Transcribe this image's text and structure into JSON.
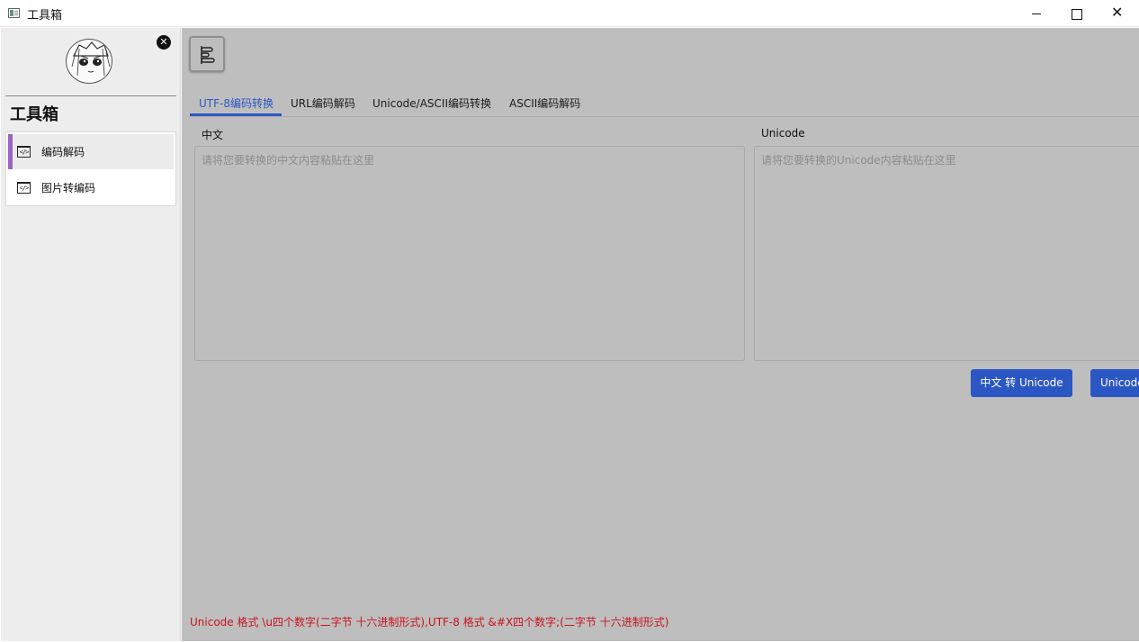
{
  "window": {
    "title": "工具箱",
    "controls": [
      "minimize",
      "maximize",
      "close"
    ]
  },
  "sidebar": {
    "heading": "工具箱",
    "close_icon": "close-circle-icon",
    "items": [
      {
        "label": "编码解码",
        "icon": "code-icon",
        "active": true
      },
      {
        "label": "图片转编码",
        "icon": "code-icon",
        "active": false
      }
    ]
  },
  "main": {
    "menu_icon": "menu-toggle-icon",
    "tabs": [
      {
        "label": "UTF-8编码转换",
        "active": true
      },
      {
        "label": "URL编码解码",
        "active": false
      },
      {
        "label": "Unicode/ASCII编码转换",
        "active": false
      },
      {
        "label": "ASCII编码解码",
        "active": false
      }
    ],
    "left_panel": {
      "label": "中文",
      "value": "",
      "placeholder": "请将您要转换的中文内容粘贴在这里"
    },
    "right_panel": {
      "label": "Unicode",
      "value": "",
      "placeholder": "请将您要转换的Unicode内容粘贴在这里"
    },
    "buttons": {
      "to_unicode": "中文 转 Unicode",
      "to_chinese": "Unicode 转 中文"
    },
    "footer_note": "Unicode 格式 \\u四个数字(二字节 十六进制形式),UTF-8 格式  &#X四个数字;(二字节 十六进制形式)"
  },
  "colors": {
    "accent": "#2b57c4",
    "active_indicator": "#9a64c4",
    "note_text": "#c8141e",
    "overlay": "#bebebe"
  }
}
